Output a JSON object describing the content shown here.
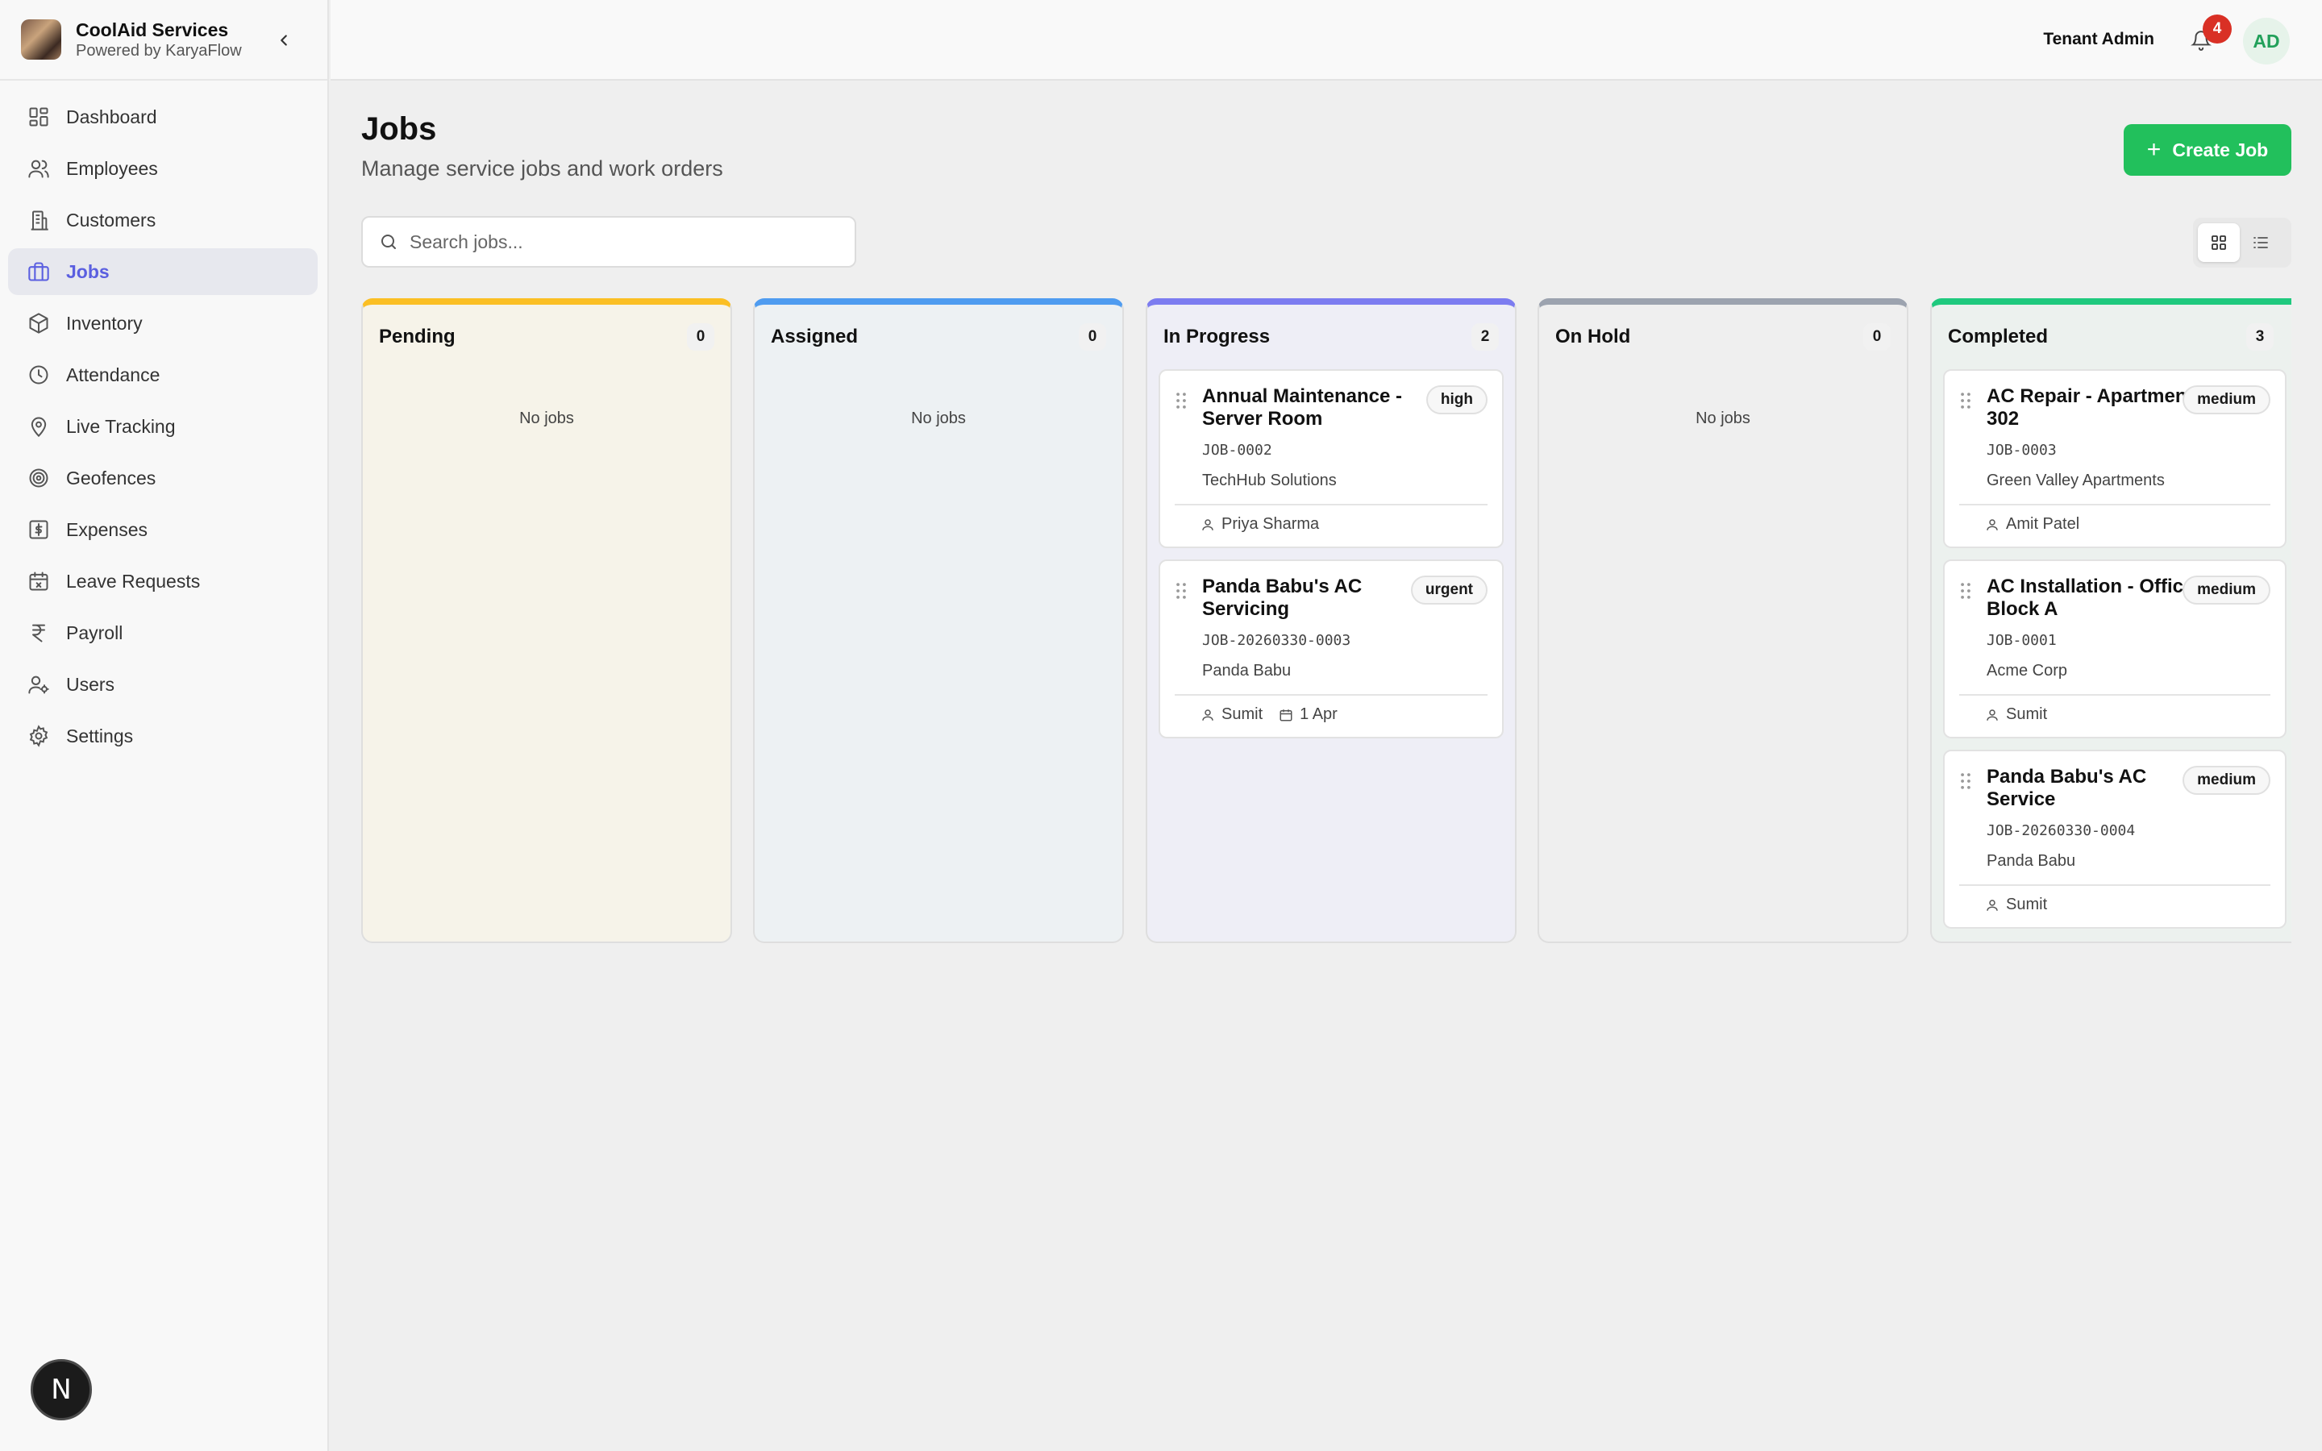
{
  "brand": {
    "title": "CoolAid Services",
    "subtitle": "Powered by KaryaFlow"
  },
  "sidebar": {
    "items": [
      {
        "label": "Dashboard",
        "icon": "dashboard-icon"
      },
      {
        "label": "Employees",
        "icon": "users-icon"
      },
      {
        "label": "Customers",
        "icon": "building-icon"
      },
      {
        "label": "Jobs",
        "icon": "briefcase-icon",
        "active": true
      },
      {
        "label": "Inventory",
        "icon": "package-icon"
      },
      {
        "label": "Attendance",
        "icon": "clock-icon"
      },
      {
        "label": "Live Tracking",
        "icon": "map-pin-icon"
      },
      {
        "label": "Geofences",
        "icon": "target-icon"
      },
      {
        "label": "Expenses",
        "icon": "dollar-icon"
      },
      {
        "label": "Leave Requests",
        "icon": "calendar-x-icon"
      },
      {
        "label": "Payroll",
        "icon": "rupee-icon"
      },
      {
        "label": "Users",
        "icon": "user-cog-icon"
      },
      {
        "label": "Settings",
        "icon": "gear-icon"
      }
    ]
  },
  "header": {
    "tenant_label": "Tenant Admin",
    "notification_count": "4",
    "avatar_initials": "AD"
  },
  "page": {
    "title": "Jobs",
    "subtitle": "Manage service jobs and work orders",
    "create_label": "Create Job",
    "search_placeholder": "Search jobs..."
  },
  "colors": {
    "pending": "#fbbf24",
    "assigned": "#4f9cf0",
    "in_progress": "#7c7cf0",
    "on_hold": "#9ca3af",
    "completed": "#1fc97e",
    "accent": "#22c05c"
  },
  "board": {
    "empty_label": "No jobs",
    "columns": [
      {
        "title": "Pending",
        "count": "0",
        "cards": []
      },
      {
        "title": "Assigned",
        "count": "0",
        "cards": []
      },
      {
        "title": "In Progress",
        "count": "2",
        "cards": [
          {
            "title": "Annual Maintenance - Server Room",
            "priority": "high",
            "code": "JOB-0002",
            "customer": "TechHub Solutions",
            "assignee": "Priya Sharma",
            "date": ""
          },
          {
            "title": "Panda Babu's AC Servicing",
            "priority": "urgent",
            "code": "JOB-20260330-0003",
            "customer": "Panda Babu",
            "assignee": "Sumit",
            "date": "1 Apr"
          }
        ]
      },
      {
        "title": "On Hold",
        "count": "0",
        "cards": []
      },
      {
        "title": "Completed",
        "count": "3",
        "cards": [
          {
            "title": "AC Repair - Apartment 302",
            "priority": "medium",
            "code": "JOB-0003",
            "customer": "Green Valley Apartments",
            "assignee": "Amit Patel",
            "date": ""
          },
          {
            "title": "AC Installation - Office Block A",
            "priority": "medium",
            "code": "JOB-0001",
            "customer": "Acme Corp",
            "assignee": "Sumit",
            "date": ""
          },
          {
            "title": "Panda Babu's AC Service",
            "priority": "medium",
            "code": "JOB-20260330-0004",
            "customer": "Panda Babu",
            "assignee": "Sumit",
            "date": ""
          }
        ]
      }
    ]
  },
  "dev_badge": "N"
}
